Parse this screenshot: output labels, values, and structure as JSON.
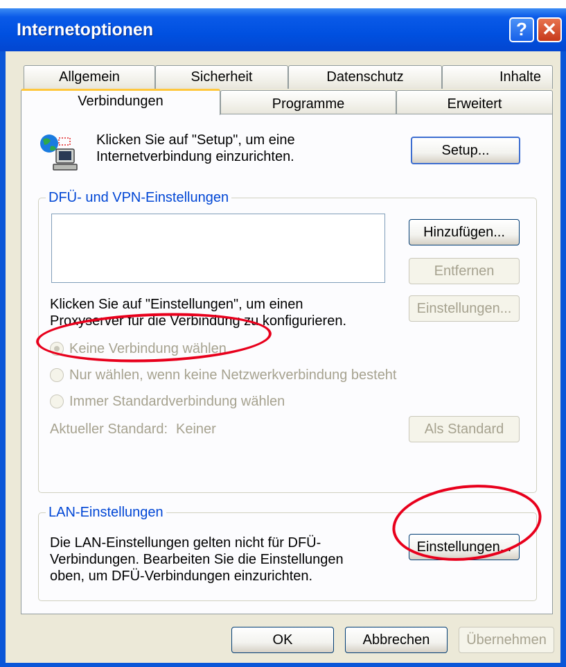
{
  "window": {
    "title": "Internetoptionen",
    "help_label": "?",
    "close_label": "✕"
  },
  "tabs": {
    "row_back": [
      "Allgemein",
      "Sicherheit",
      "Datenschutz",
      "Inhalte"
    ],
    "row_front": [
      "Verbindungen",
      "Programme",
      "Erweitert"
    ],
    "active": "Verbindungen"
  },
  "setup": {
    "description_line1": "Klicken Sie auf \"Setup\", um eine",
    "description_line2": "Internetverbindung einzurichten.",
    "button_label": "Setup..."
  },
  "dialup": {
    "legend": "DFÜ- und VPN-Einstellungen",
    "add_label": "Hinzufügen...",
    "remove_label": "Entfernen",
    "settings_label": "Einstellungen...",
    "proxy_text_line1": "Klicken Sie auf \"Einstellungen\", um einen",
    "proxy_text_line2": "Proxyserver für die Verbindung zu konfigurieren.",
    "radio_options": [
      "Keine Verbindung wählen",
      "Nur wählen, wenn keine Netzwerkverbindung besteht",
      "Immer Standardverbindung wählen"
    ],
    "selected_option": 0,
    "current_default_label": "Aktueller Standard:",
    "current_default_value": "Keiner",
    "set_default_label": "Als Standard"
  },
  "lan": {
    "legend": "LAN-Einstellungen",
    "text_line1": "Die LAN-Einstellungen gelten nicht für DFÜ-",
    "text_line2": "Verbindungen. Bearbeiten Sie die Einstellungen",
    "text_line3": "oben, um DFÜ-Verbindungen einzurichten.",
    "settings_label": "Einstellungen..."
  },
  "footer": {
    "ok_label": "OK",
    "cancel_label": "Abbrechen",
    "apply_label": "Übernehmen"
  },
  "colors": {
    "titlebar": "#0050e0",
    "legend_text": "#0046d5",
    "annotation": "#e8001c",
    "dialog_bg": "#ece9d8"
  },
  "icons": {
    "setup": "globe-computer-icon",
    "help": "help-icon",
    "close": "close-icon"
  }
}
